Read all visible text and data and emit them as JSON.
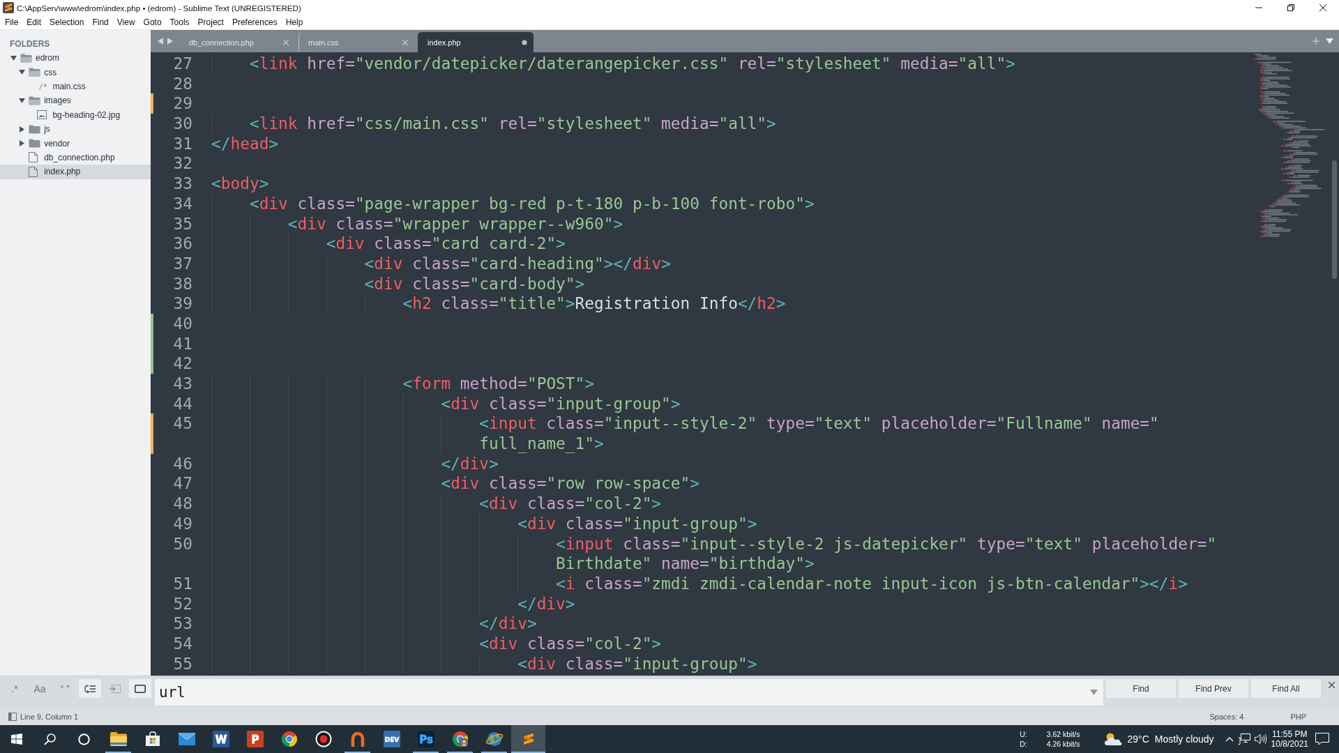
{
  "window": {
    "title": "C:\\AppServ\\www\\edrom\\index.php • (edrom) - Sublime Text (UNREGISTERED)"
  },
  "menu": [
    "File",
    "Edit",
    "Selection",
    "Find",
    "View",
    "Goto",
    "Tools",
    "Project",
    "Preferences",
    "Help"
  ],
  "sidebar": {
    "heading": "FOLDERS",
    "tree": [
      {
        "name": "edrom",
        "kind": "folder",
        "expanded": true,
        "selected": false,
        "children": [
          {
            "name": "css",
            "kind": "folder",
            "expanded": true,
            "selected": false,
            "children": [
              {
                "name": "main.css",
                "kind": "glyph",
                "glyph": "/*",
                "selected": false
              }
            ]
          },
          {
            "name": "images",
            "kind": "folder",
            "expanded": true,
            "selected": false,
            "children": [
              {
                "name": "bg-heading-02.jpg",
                "kind": "image",
                "selected": false
              }
            ]
          },
          {
            "name": "js",
            "kind": "folder",
            "expanded": false,
            "selected": false
          },
          {
            "name": "vendor",
            "kind": "folder",
            "expanded": false,
            "selected": false
          },
          {
            "name": "db_connection.php",
            "kind": "document",
            "selected": false
          },
          {
            "name": "index.php",
            "kind": "document",
            "selected": true
          }
        ]
      }
    ]
  },
  "tabs": [
    {
      "label": "db_connection.php",
      "selected": false,
      "dirty": false
    },
    {
      "label": "main.css",
      "selected": false,
      "dirty": false
    },
    {
      "label": "index.php",
      "selected": true,
      "dirty": true
    }
  ],
  "editor": {
    "lines": [
      {
        "number": "27",
        "text": "    <link href=\"vendor/datepicker/daterangepicker.css\" rel=\"stylesheet\" media=\"all\">"
      },
      {
        "number": "28"
      },
      {
        "number": "29",
        "color": "#f9ae58"
      },
      {
        "number": "30",
        "text": "    <link href=\"css/main.css\" rel=\"stylesheet\" media=\"all\">"
      },
      {
        "number": "31",
        "text": "</head>"
      },
      {
        "number": "32"
      },
      {
        "number": "33",
        "text": "<body>"
      },
      {
        "number": "34",
        "text": "    <div class=\"page-wrapper bg-red p-t-180 p-b-100 font-robo\">"
      },
      {
        "number": "35",
        "text": "        <div class=\"wrapper wrapper--w960\">"
      },
      {
        "number": "36",
        "text": "            <div class=\"card card-2\">"
      },
      {
        "number": "37",
        "text": "                <div class=\"card-heading\"></div>"
      },
      {
        "number": "38",
        "text": "                <div class=\"card-body\">"
      },
      {
        "number": "39",
        "text": "                    <h2 class=\"title\">Registration Info</h2>"
      },
      {
        "number": "40",
        "color": "#94c38f"
      },
      {
        "number": "41",
        "color": "#94c38f"
      },
      {
        "number": "42",
        "color": "#94c38f"
      },
      {
        "number": "43",
        "text": "                    <form method=\"POST\">"
      },
      {
        "number": "44",
        "text": "                        <div class=\"input-group\">"
      },
      {
        "number": "45",
        "text": "                            <input class=\"input--style-2\" type=\"text\" placeholder=\"Fullname\" name=\"",
        "continuation": "full_name_1\">",
        "color": "#f9ae58"
      },
      {
        "number": "46",
        "text": "                        </div>"
      },
      {
        "number": "47",
        "text": "                        <div class=\"row row-space\">"
      },
      {
        "number": "48",
        "text": "                            <div class=\"col-2\">"
      },
      {
        "number": "49",
        "text": "                                <div class=\"input-group\">"
      },
      {
        "number": "50",
        "text": "                                    <input class=\"input--style-2 js-datepicker\" type=\"text\" placeholder=\"",
        "continuation": "Birthdate\" name=\"birthday\">"
      },
      {
        "number": "51",
        "text": "                                    <i class=\"zmdi zmdi-calendar-note input-icon js-btn-calendar\"></i>"
      },
      {
        "number": "52",
        "text": "                                </div>"
      },
      {
        "number": "53",
        "text": "                            </div>"
      },
      {
        "number": "54",
        "text": "                            <div class=\"col-2\">"
      },
      {
        "number": "55",
        "text": "                                <div class=\"input-group\">"
      }
    ]
  },
  "find_panel": {
    "options": [
      {
        "kind": "text",
        "label": ".*",
        "on": false
      },
      {
        "kind": "text",
        "label": "Aa",
        "on": false
      },
      {
        "kind": "text",
        "label": "“ ”",
        "on": false
      },
      {
        "kind": "wrap",
        "on": true
      },
      {
        "kind": "in-selection",
        "on": false
      },
      {
        "kind": "highlight",
        "on": true
      }
    ],
    "query": "url",
    "buttons": [
      "Find",
      "Find Prev",
      "Find All"
    ]
  },
  "status_bar": {
    "position": "Line 9, Column 1",
    "indentation": "Spaces: 4",
    "syntax": "PHP"
  },
  "taskbar": {
    "apps": [
      {
        "kind": "folder",
        "running": true,
        "active": false
      },
      {
        "kind": "store",
        "running": false,
        "active": false
      },
      {
        "kind": "mail",
        "running": false,
        "active": false
      },
      {
        "kind": "tile",
        "color": "#2b579a",
        "glyph": {
          "text": "W"
        },
        "running": false,
        "active": false
      },
      {
        "kind": "tile",
        "color": "#c9411f",
        "glyph": {
          "text": "P"
        },
        "running": false,
        "active": false
      },
      {
        "kind": "browser",
        "running": false,
        "active": false
      },
      {
        "kind": "recorder",
        "running": false,
        "active": false
      },
      {
        "kind": "arc",
        "running": true,
        "active": false
      },
      {
        "kind": "tile",
        "color": "#3a6db0",
        "glyph": {
          "text": "DEV"
        },
        "running": false,
        "active": false
      },
      {
        "kind": "tile",
        "color": "#0b2238",
        "glyph": {
          "text": "Ps",
          "color": "#31a8ff"
        },
        "running": true,
        "active": false
      },
      {
        "kind": "browser-profile",
        "running": true,
        "active": false
      },
      {
        "kind": "globe",
        "running": true,
        "active": false
      },
      {
        "kind": "logo",
        "running": true,
        "active": true
      }
    ],
    "network": {
      "upload_label": "U:",
      "upload_rate": "3.62 kbit/s",
      "download_label": "D:",
      "download_rate": "4.26 kbit/s"
    },
    "weather": {
      "temperature": "29°C",
      "condition": "Mostly cloudy"
    },
    "clock": {
      "time": "11:55 PM",
      "date": "10/8/2021"
    }
  }
}
